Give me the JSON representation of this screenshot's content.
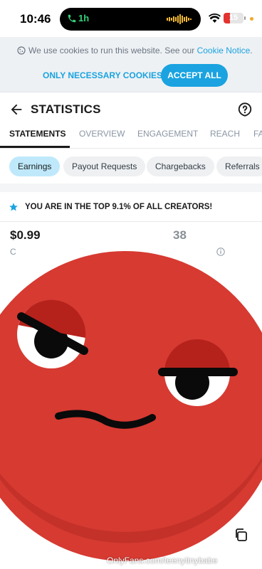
{
  "status_bar": {
    "time": "10:46",
    "call_duration": "1h",
    "battery_level": "15",
    "battery_fraction": 0.15,
    "icons": [
      "phone-icon",
      "audio-wave-icon",
      "wifi-icon",
      "battery-icon"
    ]
  },
  "cookie_banner": {
    "text": "We use cookies to run this website. See our ",
    "link": "Cookie Notice",
    "period": ".",
    "necessary_label": "ONLY NECESSARY COOKIES",
    "accept_label": "ACCEPT ALL",
    "accent_color": "#1aa3e0"
  },
  "header": {
    "title": "STATISTICS",
    "icons": [
      "back-arrow-icon",
      "help-icon"
    ]
  },
  "tabs": [
    {
      "label": "STATEMENTS",
      "active": true
    },
    {
      "label": "OVERVIEW",
      "active": false
    },
    {
      "label": "ENGAGEMENT",
      "active": false
    },
    {
      "label": "REACH",
      "active": false
    },
    {
      "label": "FA",
      "active": false
    }
  ],
  "chips": [
    {
      "label": "Earnings",
      "active": true
    },
    {
      "label": "Payout Requests",
      "active": false
    },
    {
      "label": "Chargebacks",
      "active": false
    },
    {
      "label": "Referrals",
      "active": false
    }
  ],
  "top_banner": {
    "text": "YOU ARE IN THE TOP 9.1% OF ALL CREATORS!",
    "icon": "star-icon"
  },
  "earnings": {
    "left_amount": "$0.99",
    "right_amount": "38"
  },
  "watermark": "OnlyFans.com/teenytinybabe"
}
